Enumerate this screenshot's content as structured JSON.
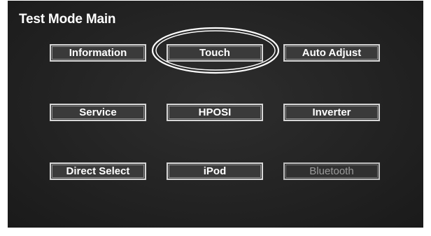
{
  "screen": {
    "title": "Test Mode Main"
  },
  "buttons": {
    "information": "Information",
    "touch": "Touch",
    "auto_adjust": "Auto Adjust",
    "service": "Service",
    "hposi": "HPOSI",
    "inverter": "Inverter",
    "direct_select": "Direct Select",
    "ipod": "iPod",
    "bluetooth": "Bluetooth"
  },
  "colors": {
    "screen_background": "#232323",
    "button_border": "#d6d6d6",
    "text": "#ffffff",
    "disabled_text": "#9a9a9a"
  }
}
